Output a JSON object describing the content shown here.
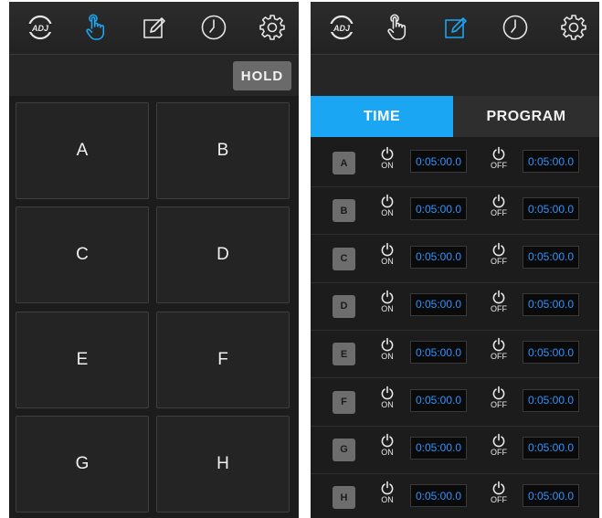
{
  "nav": {
    "logo_text": "ADJ"
  },
  "left_screen": {
    "hold_label": "HOLD",
    "pads": [
      {
        "label": "A"
      },
      {
        "label": "B"
      },
      {
        "label": "C"
      },
      {
        "label": "D"
      },
      {
        "label": "E"
      },
      {
        "label": "F"
      },
      {
        "label": "G"
      },
      {
        "label": "H"
      }
    ]
  },
  "right_screen": {
    "tabs": {
      "time": "TIME",
      "program": "PROGRAM"
    },
    "on_label": "ON",
    "off_label": "OFF",
    "rows": [
      {
        "label": "A",
        "on_time": "0:05:00.0",
        "off_time": "0:05:00.0"
      },
      {
        "label": "B",
        "on_time": "0:05:00.0",
        "off_time": "0:05:00.0"
      },
      {
        "label": "C",
        "on_time": "0:05:00.0",
        "off_time": "0:05:00.0"
      },
      {
        "label": "D",
        "on_time": "0:05:00.0",
        "off_time": "0:05:00.0"
      },
      {
        "label": "E",
        "on_time": "0:05:00.0",
        "off_time": "0:05:00.0"
      },
      {
        "label": "F",
        "on_time": "0:05:00.0",
        "off_time": "0:05:00.0"
      },
      {
        "label": "G",
        "on_time": "0:05:00.0",
        "off_time": "0:05:00.0"
      },
      {
        "label": "H",
        "on_time": "0:05:00.0",
        "off_time": "0:05:00.0"
      }
    ]
  },
  "colors": {
    "accent": "#1aa6f2",
    "icon": "#e6e6e6",
    "time_text": "#2f93ff",
    "background": "#1c1c1c"
  }
}
